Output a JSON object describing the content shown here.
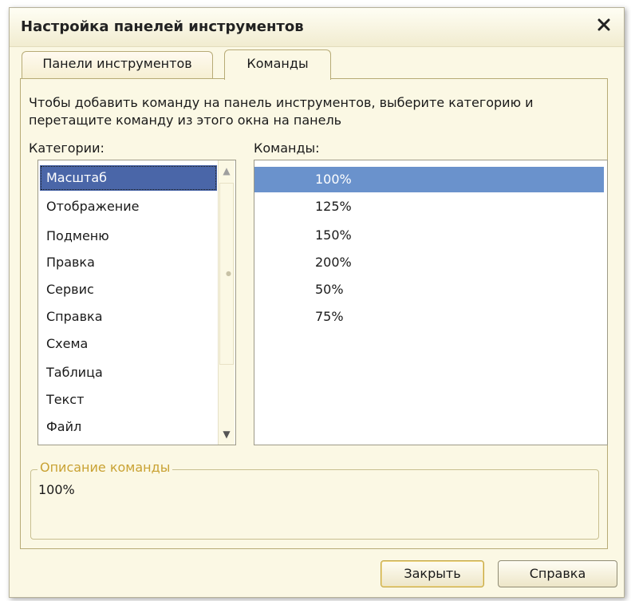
{
  "window": {
    "title": "Настройка панелей инструментов",
    "close_icon": "close-icon"
  },
  "tabs": [
    {
      "label": "Панели инструментов",
      "active": false
    },
    {
      "label": "Команды",
      "active": true
    }
  ],
  "hint": "Чтобы добавить команду на панель инструментов, выберите категорию и перетащите команду из этого окна на панель",
  "categories": {
    "label": "Категории:",
    "selected": "Масштаб",
    "items": [
      "Масштаб",
      "Отображение",
      "Подменю",
      "Правка",
      "Сервис",
      "Справка",
      "Схема",
      "Таблица",
      "Текст",
      "Файл"
    ]
  },
  "commands": {
    "label": "Команды:",
    "selected": "100%",
    "items": [
      "100%",
      "125%",
      "150%",
      "200%",
      "50%",
      "75%"
    ]
  },
  "description": {
    "legend": "Описание команды",
    "text": "100%"
  },
  "buttons": {
    "close_label": "Закрыть",
    "help_label": "Справка"
  },
  "colors": {
    "dialog_bg": "#fbf8e4",
    "category_selection": "#4a66a8",
    "command_selection": "#6a92cc",
    "legend_text": "#c9a233"
  }
}
